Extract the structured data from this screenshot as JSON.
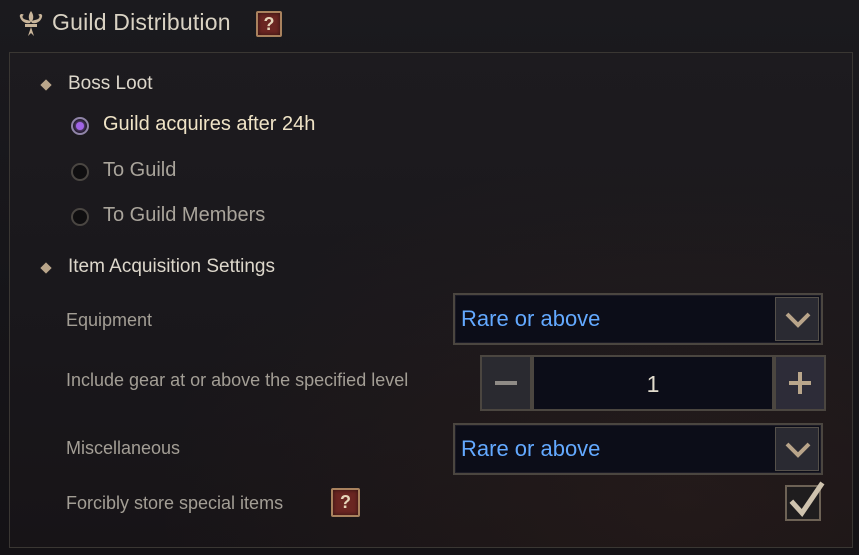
{
  "window": {
    "title": "Guild Distribution",
    "help_glyph": "?"
  },
  "boss_loot": {
    "heading": "Boss Loot",
    "options": [
      {
        "label": "Guild acquires after 24h",
        "selected": true
      },
      {
        "label": "To Guild",
        "selected": false
      },
      {
        "label": "To Guild Members",
        "selected": false
      }
    ]
  },
  "item_acquisition": {
    "heading": "Item Acquisition Settings",
    "equipment": {
      "label": "Equipment",
      "value": "Rare or above"
    },
    "gear_level": {
      "label": "Include gear at or above the specified level",
      "value": "1"
    },
    "miscellaneous": {
      "label": "Miscellaneous",
      "value": "Rare or above"
    },
    "forcibly_store": {
      "label": "Forcibly store special items",
      "help_glyph": "?",
      "checked": true
    }
  },
  "icons": {
    "title": "fleur-de-lis-icon",
    "dropdown": "chevron-down-icon",
    "minus": "minus-icon",
    "plus": "plus-icon",
    "check": "checkmark-icon"
  },
  "colors": {
    "dropdown_text": "#63a9ff",
    "radio_selected": "#a063e6",
    "help_button": "#6b2622"
  }
}
